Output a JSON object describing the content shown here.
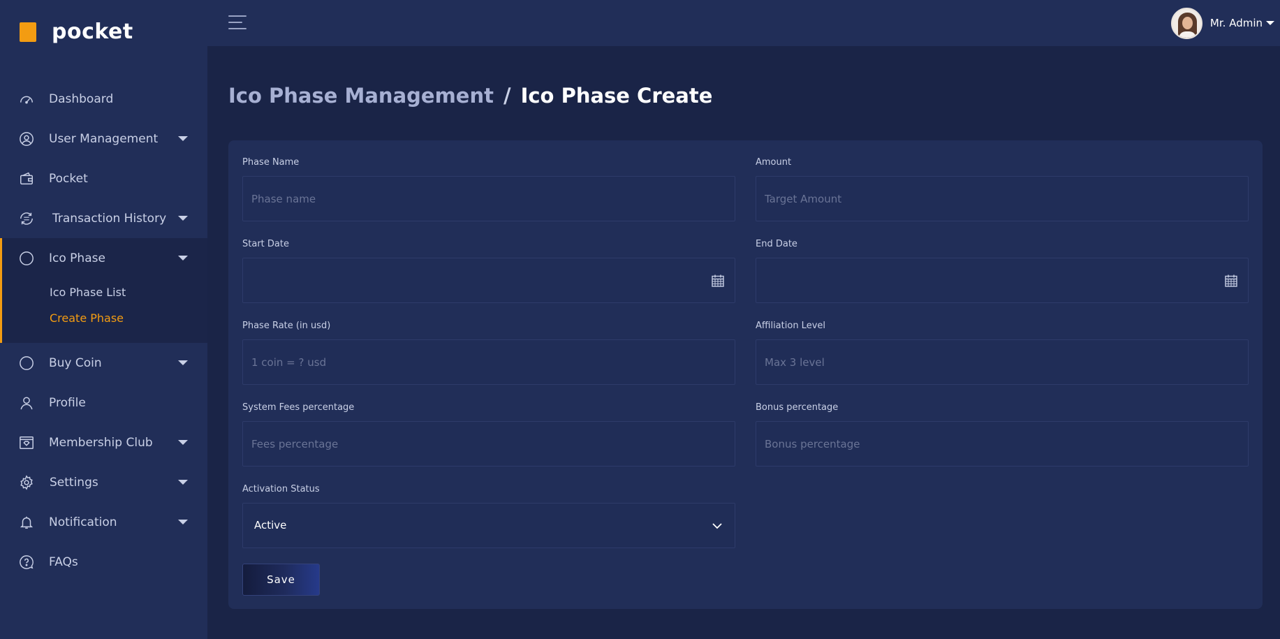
{
  "brand": {
    "logo_c": "c",
    "logo_text": "pocket",
    "accent": "#f39c12"
  },
  "sidebar": {
    "items": [
      {
        "label": "Dashboard",
        "icon": "speedometer-icon",
        "caret": false
      },
      {
        "label": "User Management",
        "icon": "user-circle-icon",
        "caret": true
      },
      {
        "label": "Pocket",
        "icon": "wallet-icon",
        "caret": false
      },
      {
        "label": "Transaction History",
        "icon": "exchange-icon",
        "caret": true
      },
      {
        "label": "Ico Phase",
        "icon": "circle-icon",
        "caret": true,
        "active": true,
        "children": [
          {
            "label": "Ico Phase List"
          },
          {
            "label": "Create Phase",
            "active": true
          }
        ]
      },
      {
        "label": "Buy Coin",
        "icon": "circle-icon",
        "caret": true
      },
      {
        "label": "Profile",
        "icon": "person-icon",
        "caret": false
      },
      {
        "label": "Membership Club",
        "icon": "membership-card-icon",
        "caret": true
      },
      {
        "label": "Settings",
        "icon": "gear-icon",
        "caret": true
      },
      {
        "label": "Notification",
        "icon": "bell-icon",
        "caret": true
      },
      {
        "label": "FAQs",
        "icon": "question-bubble-icon",
        "caret": false
      }
    ]
  },
  "topbar": {
    "user_name": "Mr. Admin"
  },
  "breadcrumb": {
    "parent": "Ico Phase Management",
    "separator": "/",
    "current": "Ico Phase Create"
  },
  "form": {
    "phase_name": {
      "label": "Phase Name",
      "placeholder": "Phase name",
      "value": ""
    },
    "amount": {
      "label": "Amount",
      "placeholder": "Target Amount",
      "value": ""
    },
    "start_date": {
      "label": "Start Date",
      "value": ""
    },
    "end_date": {
      "label": "End Date",
      "value": ""
    },
    "phase_rate": {
      "label": "Phase Rate (in usd)",
      "placeholder": "1 coin = ? usd",
      "value": ""
    },
    "affiliation_level": {
      "label": "Affiliation Level",
      "placeholder": "Max 3 level",
      "value": ""
    },
    "system_fees": {
      "label": "System Fees percentage",
      "placeholder": "Fees percentage",
      "value": ""
    },
    "bonus": {
      "label": "Bonus percentage",
      "placeholder": "Bonus percentage",
      "value": ""
    },
    "activation_status": {
      "label": "Activation Status",
      "selected": "Active"
    },
    "save_label": "Save"
  }
}
